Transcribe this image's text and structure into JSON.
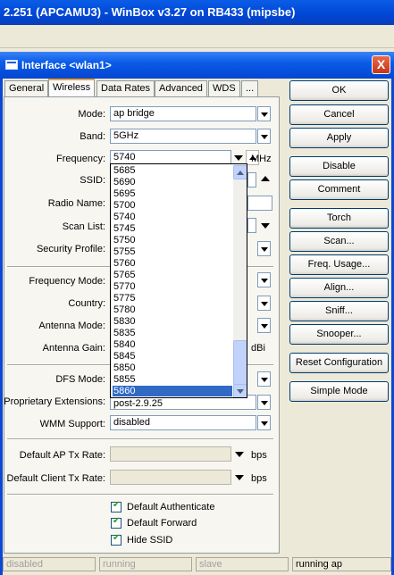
{
  "app": {
    "title": "2.251 (APCAMU3) - WinBox v3.27 on RB433 (mipsbe)"
  },
  "window": {
    "title": "Interface <wlan1>",
    "close": "X"
  },
  "tabs": [
    "General",
    "Wireless",
    "Data Rates",
    "Advanced",
    "WDS",
    "..."
  ],
  "active_tab": "Wireless",
  "form": {
    "mode": {
      "label": "Mode:",
      "value": "ap bridge"
    },
    "band": {
      "label": "Band:",
      "value": "5GHz"
    },
    "frequency": {
      "label": "Frequency:",
      "value": "5740",
      "unit": "MHz"
    },
    "ssid": {
      "label": "SSID:"
    },
    "radio_name": {
      "label": "Radio Name:"
    },
    "scan_list": {
      "label": "Scan List:"
    },
    "security_profile": {
      "label": "Security Profile:"
    },
    "frequency_mode": {
      "label": "Frequency Mode:"
    },
    "country": {
      "label": "Country:"
    },
    "antenna_mode": {
      "label": "Antenna Mode:"
    },
    "antenna_gain": {
      "label": "Antenna Gain:",
      "unit": "dBi"
    },
    "dfs_mode": {
      "label": "DFS Mode:"
    },
    "proprietary_extensions": {
      "label": "Proprietary Extensions:",
      "value": "post-2.9.25"
    },
    "wmm_support": {
      "label": "WMM Support:",
      "value": "disabled"
    },
    "default_ap_tx_rate": {
      "label": "Default AP Tx Rate:",
      "unit": "bps"
    },
    "default_client_tx_rate": {
      "label": "Default Client Tx Rate:",
      "unit": "bps"
    },
    "default_authenticate": {
      "label": "Default Authenticate",
      "checked": true
    },
    "default_forward": {
      "label": "Default Forward",
      "checked": true
    },
    "hide_ssid": {
      "label": "Hide SSID",
      "checked": true
    }
  },
  "frequency_dropdown": {
    "options": [
      "5685",
      "5690",
      "5695",
      "5700",
      "5740",
      "5745",
      "5750",
      "5755",
      "5760",
      "5765",
      "5770",
      "5775",
      "5780",
      "5830",
      "5835",
      "5840",
      "5845",
      "5850",
      "5855",
      "5860"
    ],
    "selected": "5860"
  },
  "buttons": [
    "OK",
    "Cancel",
    "Apply",
    "Disable",
    "Comment",
    "Torch",
    "Scan...",
    "Freq. Usage...",
    "Align...",
    "Sniff...",
    "Snooper...",
    "Reset Configuration",
    "Simple Mode"
  ],
  "status": [
    "disabled",
    "running",
    "slave",
    "running ap"
  ],
  "colors": {
    "title_blue": "#0a5ce8",
    "selection": "#316ac5",
    "close_red": "#c4361b"
  }
}
